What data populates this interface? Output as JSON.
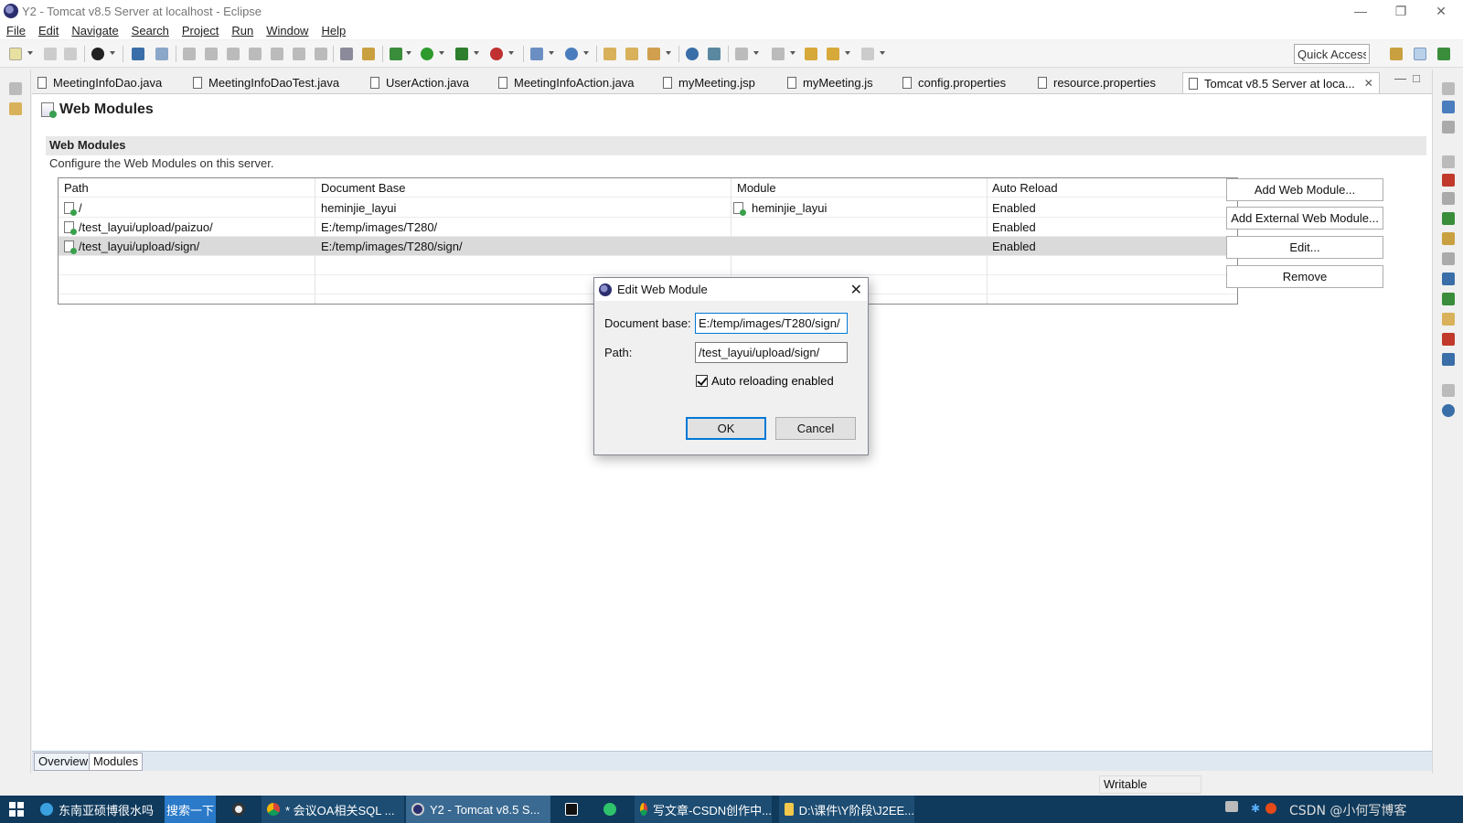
{
  "window": {
    "title": "Y2 - Tomcat v8.5 Server at localhost - Eclipse",
    "controls": [
      "—",
      "❐",
      "✕"
    ]
  },
  "menu": [
    "File",
    "Edit",
    "Navigate",
    "Search",
    "Project",
    "Run",
    "Window",
    "Help"
  ],
  "toolbar": {
    "quick_access": "Quick Access"
  },
  "tabs": [
    {
      "label": "MeetingInfoDao.java"
    },
    {
      "label": "MeetingInfoDaoTest.java"
    },
    {
      "label": "UserAction.java"
    },
    {
      "label": "MeetingInfoAction.java"
    },
    {
      "label": "myMeeting.jsp"
    },
    {
      "label": "myMeeting.js"
    },
    {
      "label": "config.properties"
    },
    {
      "label": "resource.properties"
    },
    {
      "label": "Tomcat v8.5 Server at loca..."
    }
  ],
  "page": {
    "heading": "Web Modules",
    "section_title": "Web Modules",
    "section_desc": "Configure the Web Modules on this server."
  },
  "table": {
    "columns": [
      "Path",
      "Document Base",
      "Module",
      "Auto Reload"
    ],
    "rows": [
      {
        "path": "/",
        "doc_base": "heminjie_layui",
        "module": "heminjie_layui",
        "auto_reload": "Enabled"
      },
      {
        "path": "/test_layui/upload/paizuo/",
        "doc_base": "E:/temp/images/T280/",
        "module": "",
        "auto_reload": "Enabled"
      },
      {
        "path": "/test_layui/upload/sign/",
        "doc_base": "E:/temp/images/T280/sign/",
        "module": "",
        "auto_reload": "Enabled"
      }
    ]
  },
  "buttons": {
    "add_web_module": "Add Web Module...",
    "add_external": "Add External Web Module...",
    "edit": "Edit...",
    "remove": "Remove"
  },
  "bottom_tabs": [
    "Overview",
    "Modules"
  ],
  "status": {
    "writable": "Writable"
  },
  "dialog": {
    "title": "Edit Web Module",
    "doc_base_label": "Document base:",
    "doc_base_value": "E:/temp/images/T280/sign/",
    "path_label": "Path:",
    "path_value": "/test_layui/upload/sign/",
    "auto_reload_label": "Auto reloading enabled",
    "ok": "OK",
    "cancel": "Cancel"
  },
  "taskbar": {
    "items": [
      {
        "label": "东南亚硕博很水吗"
      },
      {
        "label": "搜索一下"
      },
      {
        "label": "* 会议OA相关SQL ..."
      },
      {
        "label": "Y2 - Tomcat v8.5 S..."
      },
      {
        "label": "写文章-CSDN创作中..."
      },
      {
        "label": "D:\\课件\\Y阶段\\J2EE..."
      }
    ],
    "watermark": "CSDN @小何写博客"
  },
  "colors": {
    "accent": "#0078d7",
    "taskbar": "#0f3a5c",
    "selection": "#dadada"
  }
}
